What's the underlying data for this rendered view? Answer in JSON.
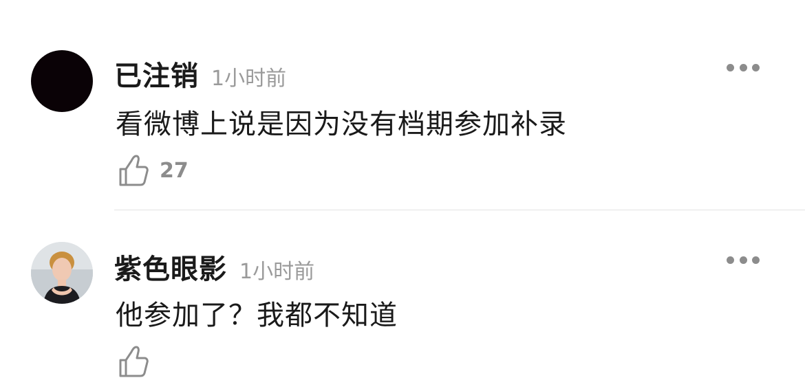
{
  "comments": [
    {
      "username": "已注销",
      "timestamp": "1小时前",
      "text": "看微博上说是因为没有档期参加补录",
      "likes": "27",
      "avatar_color": "#0a0206"
    },
    {
      "username": "紫色眼影",
      "timestamp": "1小时前",
      "text": "他参加了？我都不知道",
      "avatar_color": "#d9dde0"
    }
  ],
  "icons": {
    "more": "more-horizontal-icon",
    "like": "thumbs-up-icon"
  }
}
